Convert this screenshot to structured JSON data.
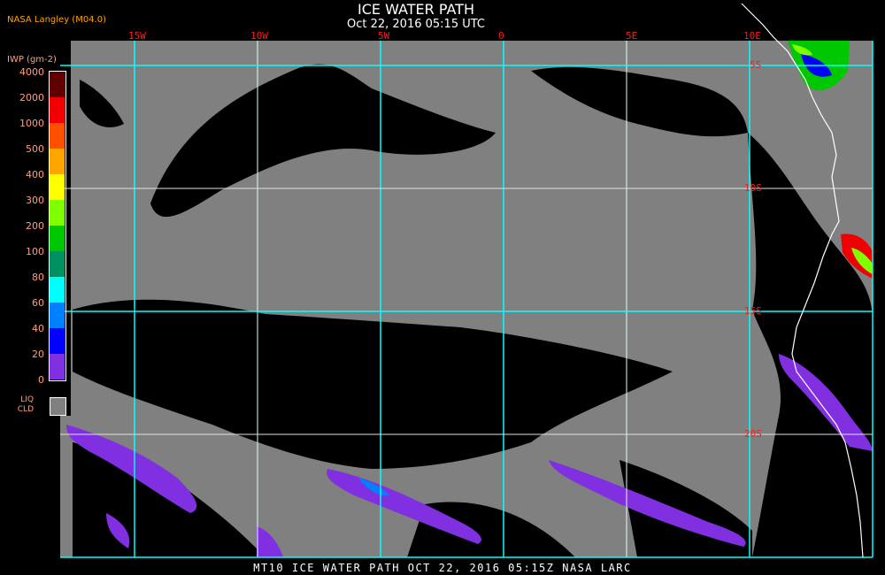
{
  "header": {
    "title": "ICE WATER PATH",
    "subtitle": "Oct 22, 2016 05:15 UTC",
    "org": "NASA Langley (M04.0)"
  },
  "legend": {
    "units": "IWP (gm-2)",
    "ticks": [
      "4000",
      "2000",
      "1000",
      "500",
      "400",
      "300",
      "200",
      "100",
      "80",
      "60",
      "40",
      "20",
      "0"
    ],
    "colors": [
      "#600000",
      "#f00000",
      "#ff5000",
      "#ffa500",
      "#ffff00",
      "#80ff00",
      "#00c800",
      "#009060",
      "#00ffff",
      "#0080ff",
      "#0000ff",
      "#8030e0"
    ],
    "liq_label_1": "LIQ",
    "liq_label_2": "CLD",
    "liq_color": "#808080"
  },
  "map": {
    "lon_labels": [
      "15W",
      "10W",
      "5W",
      "0",
      "5E",
      "10E"
    ],
    "lat_labels": [
      "5S",
      "10S",
      "15S",
      "20S"
    ],
    "grid_color": "#00ffff",
    "coast_color": "#ffffff"
  },
  "footer": {
    "caption": "MT10  ICE WATER PATH   OCT 22, 2016 05:15Z   NASA LARC"
  }
}
